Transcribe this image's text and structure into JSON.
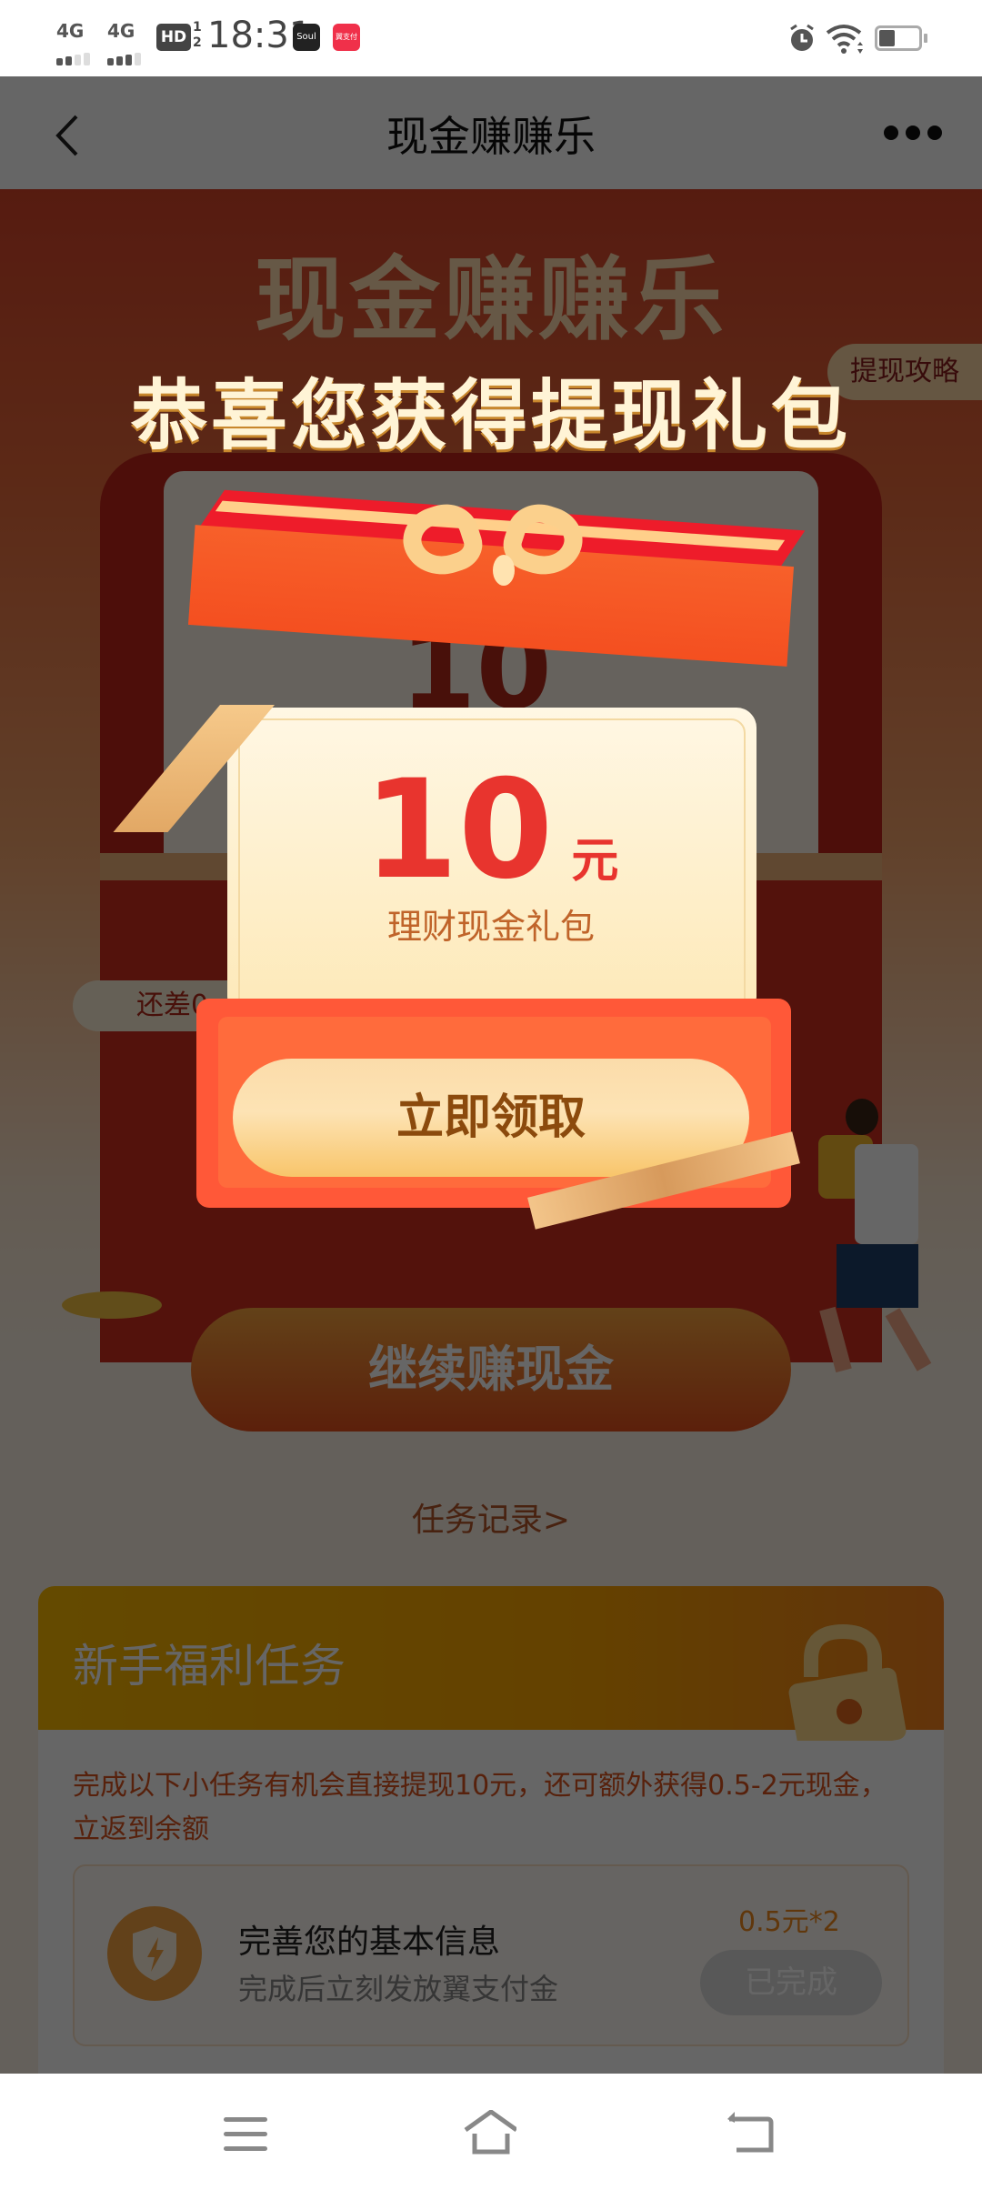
{
  "status_bar": {
    "network1": "4G",
    "network2": "4G",
    "hd_label": "HD",
    "hd_sub": "1/2",
    "time": "18:31",
    "app_icon_1": "Soul",
    "app_icon_2": "翼支付",
    "alarm_icon": "alarm-icon",
    "wifi_icon": "wifi-icon",
    "battery_level": 0.35
  },
  "navbar": {
    "back_icon": "back-chevron-icon",
    "title": "现金赚赚乐",
    "more_icon": "more-dots-icon"
  },
  "hero": {
    "title": "现金赚赚乐",
    "strategy_tag": "提现攻略",
    "card_amount": "10",
    "card_unit": "元",
    "remain_text": "还差0"
  },
  "continue_button": "继续赚现金",
  "task_record_link": "任务记录>",
  "task_section": {
    "title": "新手福利任务",
    "description": "完成以下小任务有机会直接提现10元，还可额外获得0.5-2元现金，立返到余额",
    "items": [
      {
        "name": "完善您的基本信息",
        "subtitle": "完成后立刻发放翼支付金",
        "reward": "0.5元*2",
        "status_button": "已完成",
        "icon": "shield-lightning-icon"
      }
    ]
  },
  "popup": {
    "title": "恭喜您获得提现礼包",
    "amount": "10",
    "unit": "元",
    "label": "理财现金礼包",
    "claim_button": "立即领取"
  },
  "system_nav": {
    "menu_icon": "menu-icon",
    "home_icon": "home-icon",
    "back_icon": "back-icon"
  },
  "colors": {
    "accent_red": "#e8342e",
    "gold_button": "#fbdcaa",
    "task_header": "#fbb900"
  }
}
